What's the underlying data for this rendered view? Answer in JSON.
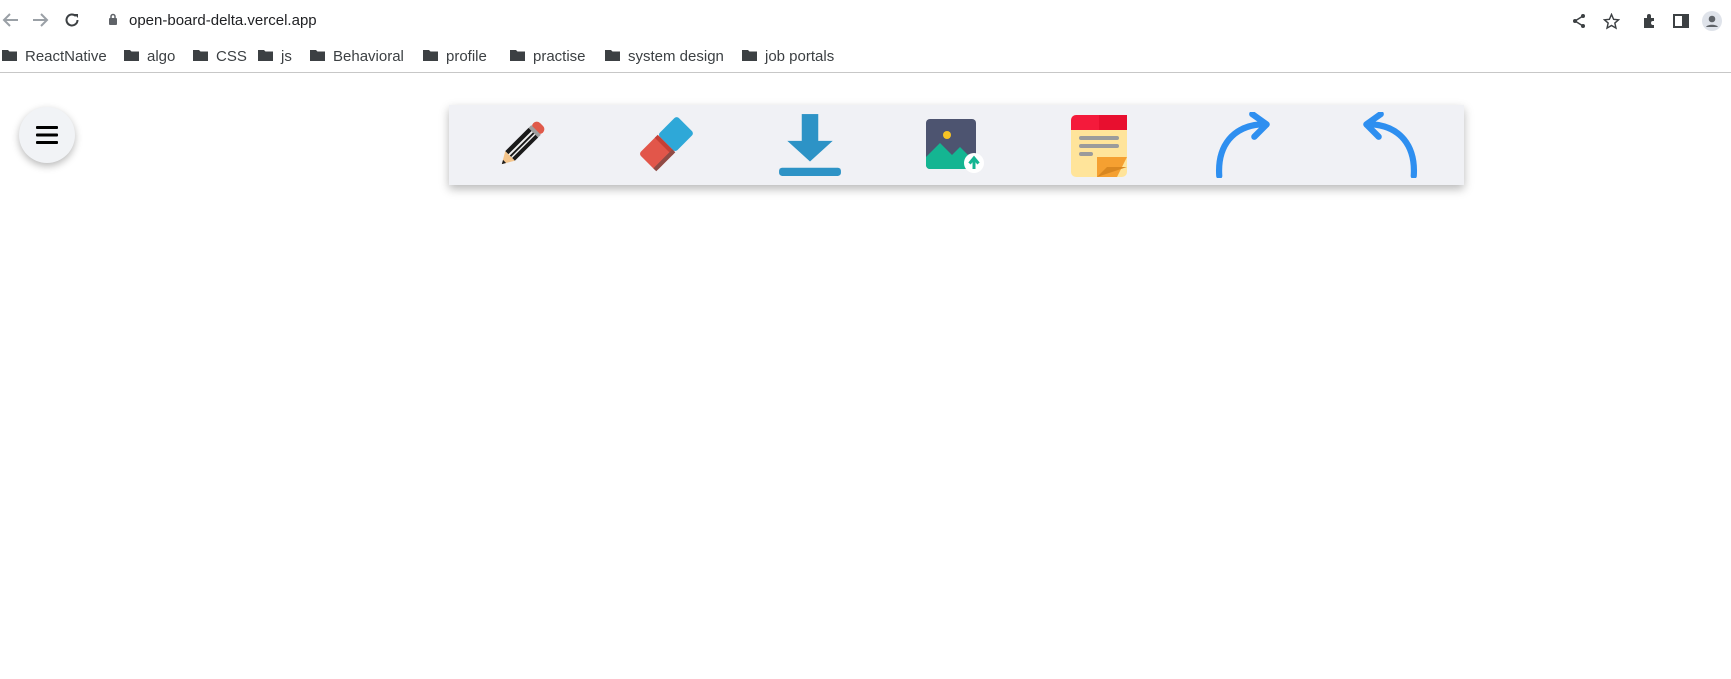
{
  "browser": {
    "url": "open-board-delta.vercel.app",
    "bookmarks": [
      {
        "label": "ReactNative"
      },
      {
        "label": "algo"
      },
      {
        "label": "CSS"
      },
      {
        "label": "js"
      },
      {
        "label": "Behavioral"
      },
      {
        "label": "profile"
      },
      {
        "label": "practise"
      },
      {
        "label": "system design"
      },
      {
        "label": "job portals"
      }
    ]
  },
  "app": {
    "menu_icon": "hamburger-icon",
    "tools": [
      {
        "icon": "pencil-icon"
      },
      {
        "icon": "eraser-icon"
      },
      {
        "icon": "download-icon"
      },
      {
        "icon": "image-upload-icon"
      },
      {
        "icon": "sticky-note-icon"
      },
      {
        "icon": "redo-icon"
      },
      {
        "icon": "undo-icon"
      }
    ]
  },
  "colors": {
    "toolbar_bg": "#f0f1f5",
    "accent_blue": "#2e8ff0",
    "download_blue": "#2d93c6"
  }
}
